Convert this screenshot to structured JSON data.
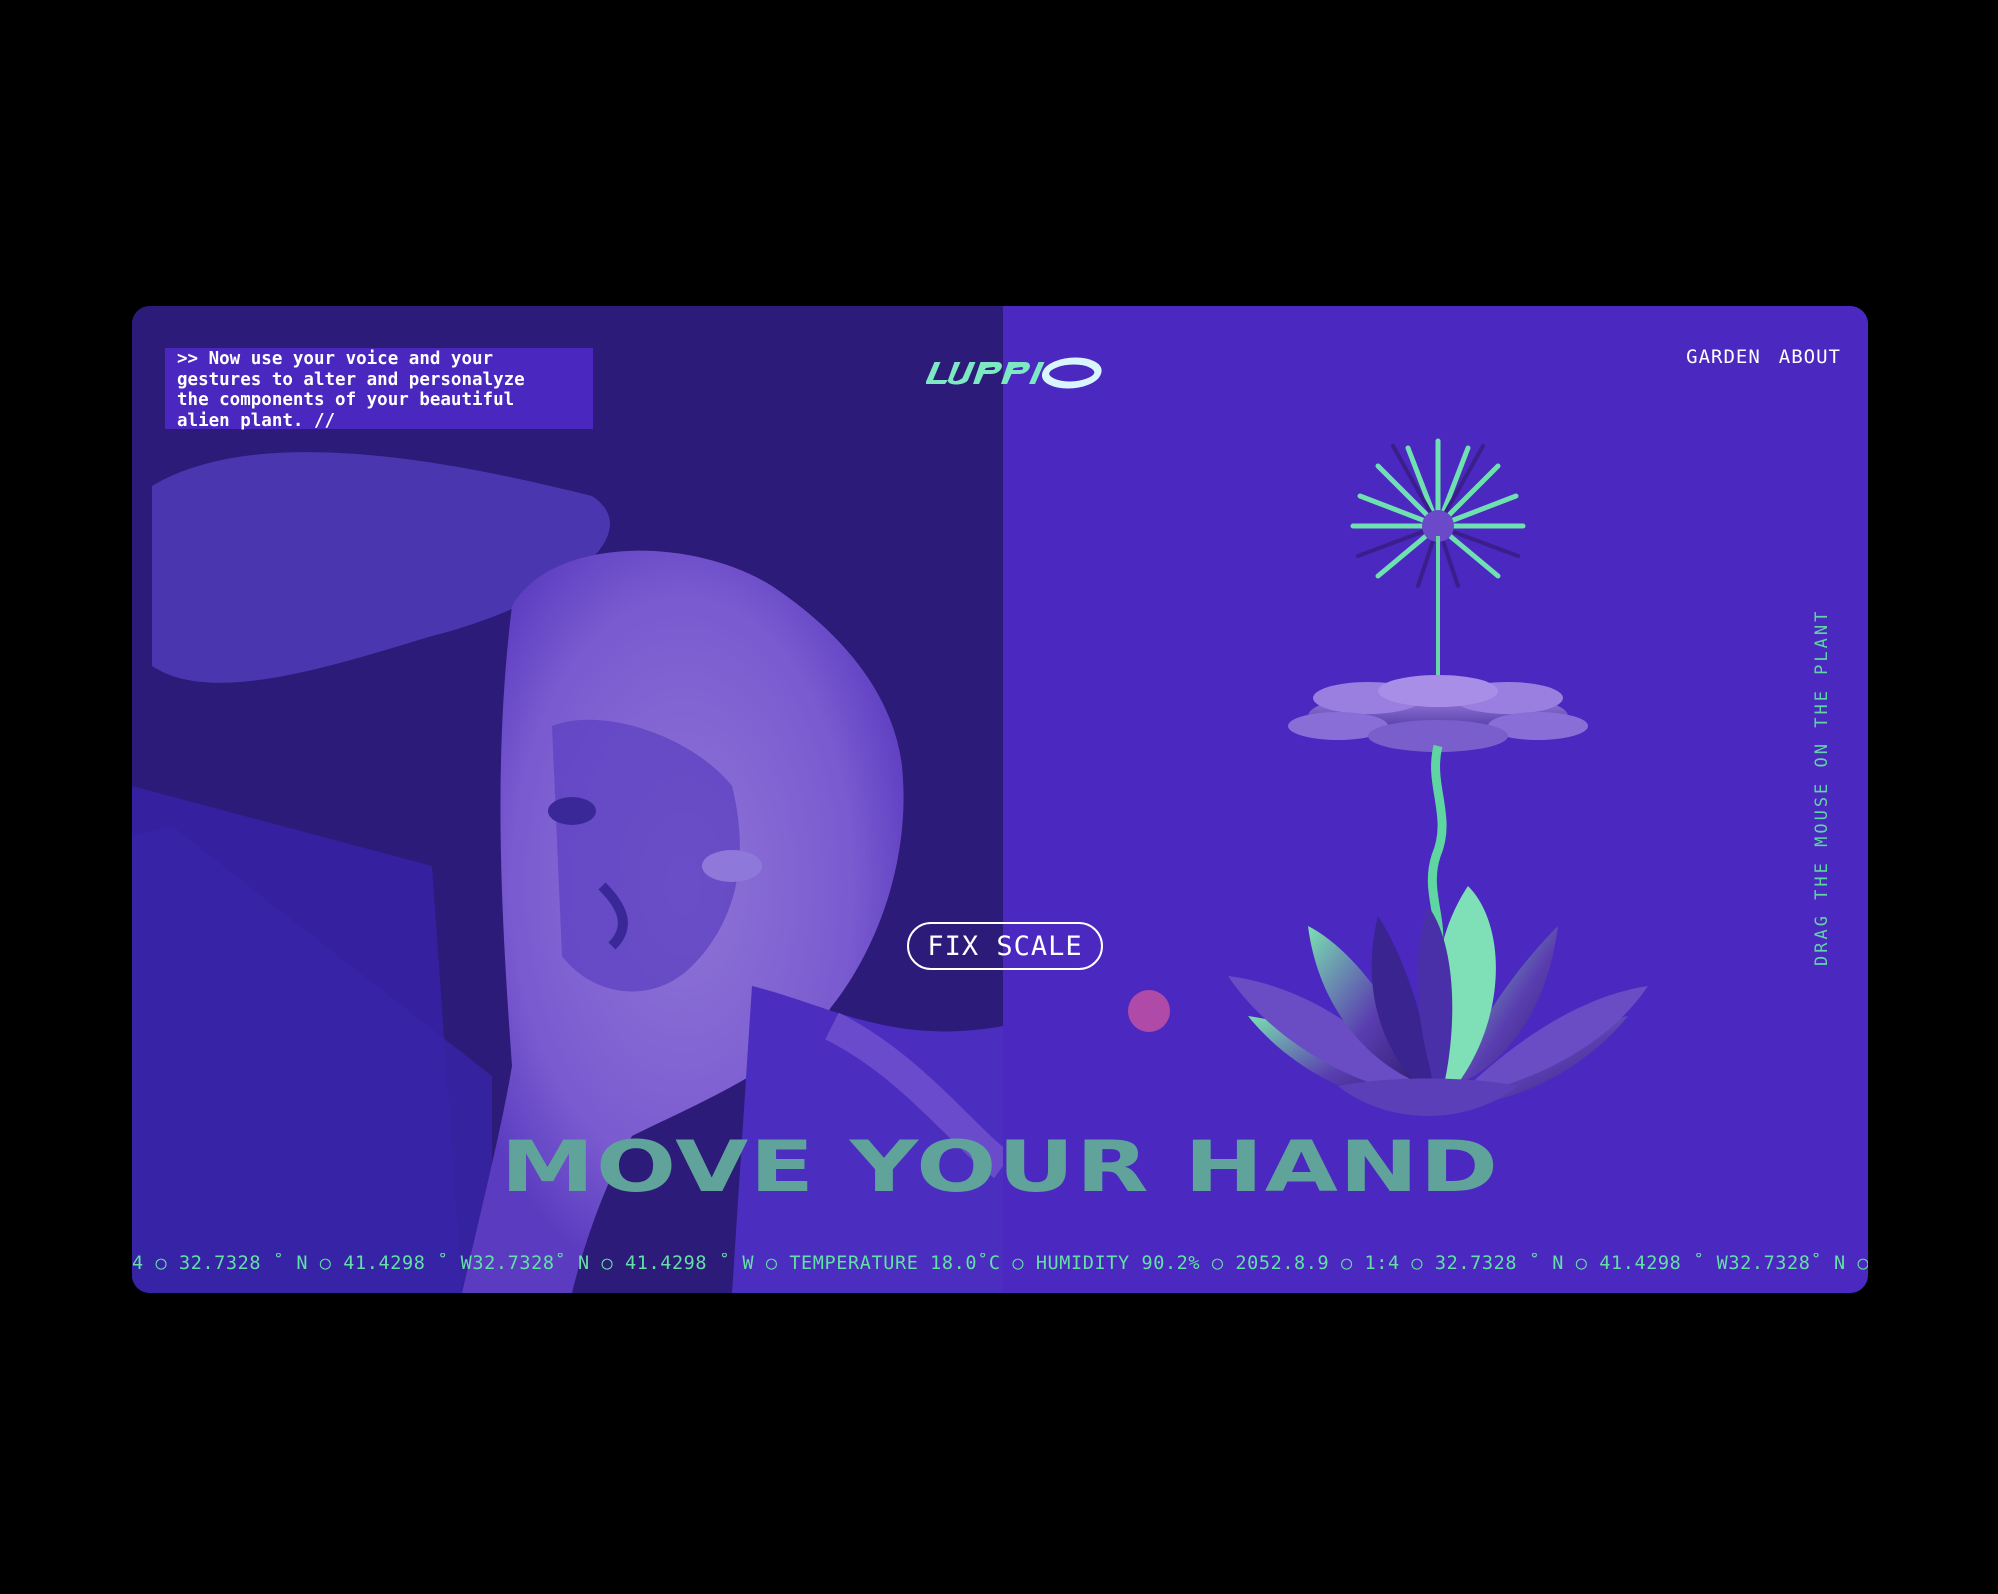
{
  "intro_text": ">> Now use your voice and your\ngestures to alter and personalyze\nthe components of your beautiful\nalien plant. //",
  "nav": {
    "garden": "GARDEN",
    "about": "ABOUT"
  },
  "side_hint": "DRAG THE MOUSE ON THE PLANT",
  "fix_scale_label": "FIX SCALE",
  "headline": "MOVE YOUR HAND",
  "ticker": "4 ○ 32.7328 ˚ N ○ 41.4298 ˚ W32.7328˚ N ○ 41.4298 ˚ W ○ TEMPERATURE 18.0˚C ○ HUMIDITY 90.2% ○ 2052.8.9 ○ 1:4 ○ 32.7328 ˚ N ○ 41.4298 ˚ W32.7328˚ N ○",
  "logo_text": "LUPPIO",
  "colors": {
    "accent": "#5fd6a2",
    "panel": "#4a28bf",
    "dot": "#b04aa8"
  }
}
